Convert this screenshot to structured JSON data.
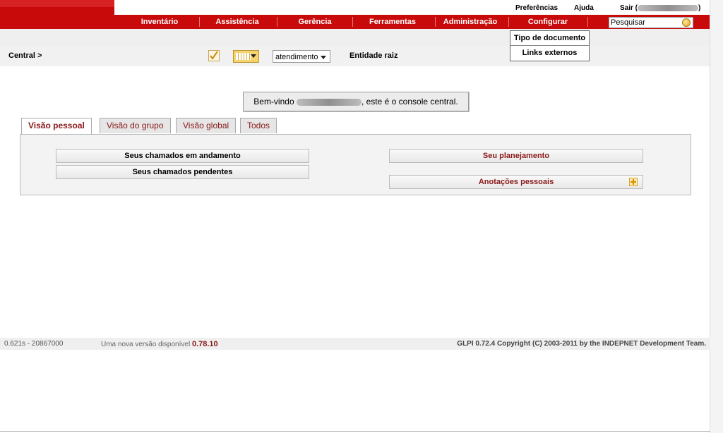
{
  "header": {
    "links": {
      "preferences": "Preferências",
      "help": "Ajuda",
      "logout_prefix": "Sair (",
      "logout_suffix": ")"
    },
    "menu": [
      "Inventário",
      "Assistência",
      "Gerência",
      "Ferramentas",
      "Administração",
      "Configurar"
    ],
    "search": {
      "value": "Pesquisar"
    }
  },
  "dropdown": {
    "items": [
      "Tipo de documento",
      "Links externos"
    ]
  },
  "toolbar": {
    "breadcrumb": "Central >",
    "select_value": "atendimento",
    "entity": "Entidade raiz"
  },
  "welcome": {
    "prefix": "Bem-vindo",
    "suffix": ", este é o console central."
  },
  "tabs": [
    "Visão pessoal",
    "Visão do grupo",
    "Visão global",
    "Todos"
  ],
  "panel": {
    "left_buttons": [
      "Seus chamados em andamento",
      "Seus chamados pendentes"
    ],
    "right_buttons": [
      "Seu planejamento",
      "Anotações pessoais"
    ]
  },
  "footer": {
    "timing": "0.621s - 20867000",
    "new_version_label": "Uma nova versão disponível",
    "new_version": "0.78.10",
    "copyright": "GLPI 0.72.4 Copyright (C) 2003-2011 by the INDEPNET Development Team."
  },
  "colors": {
    "brand_red": "#c80a0a",
    "link_red": "#8a1818"
  }
}
